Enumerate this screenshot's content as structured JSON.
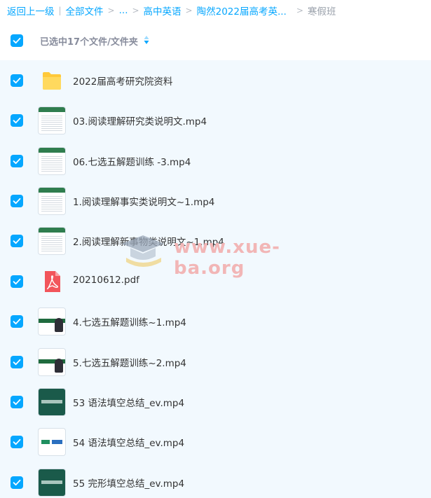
{
  "breadcrumb": {
    "back": "返回上一级",
    "all_files": "全部文件",
    "ellipsis": "...",
    "level1": "高中英语",
    "level2": "陶然2022届高考英...",
    "current": "寒假班",
    "separator": "|",
    "arrow": ">"
  },
  "selection": {
    "summary": "已选中17个文件/文件夹"
  },
  "files": [
    {
      "name": "2022届高考研究院资料",
      "type": "folder",
      "checked": true
    },
    {
      "name": "03.阅读理解研究类说明文.mp4",
      "type": "video",
      "checked": true
    },
    {
      "name": "06.七选五解题训练 -3.mp4",
      "type": "video",
      "checked": true
    },
    {
      "name": "1.阅读理解事实类说明文~1.mp4",
      "type": "video",
      "checked": true
    },
    {
      "name": "2.阅读理解新事物类说明文~1.mp4",
      "type": "video",
      "checked": true
    },
    {
      "name": "20210612.pdf",
      "type": "pdf",
      "checked": true
    },
    {
      "name": "4.七选五解题训练~1.mp4",
      "type": "video",
      "checked": true
    },
    {
      "name": "5.七选五解题训练~2.mp4",
      "type": "video",
      "checked": true
    },
    {
      "name": "53 语法填空总结_ev.mp4",
      "type": "video",
      "checked": true
    },
    {
      "name": "54 语法填空总结_ev.mp4",
      "type": "video",
      "checked": true
    },
    {
      "name": "55 完形填空总结_ev.mp4",
      "type": "video",
      "checked": true
    }
  ],
  "watermark": {
    "text": "www.xue-ba.org"
  },
  "colors": {
    "accent": "#06a7ff",
    "list_background": "#f2f9fe",
    "folder": "#ffd04a",
    "pdf": "#f2555b"
  },
  "icons": {
    "checkbox": "checkbox-checked-icon",
    "folder": "folder-icon",
    "pdf": "pdf-icon",
    "sort": "sort-icon"
  }
}
